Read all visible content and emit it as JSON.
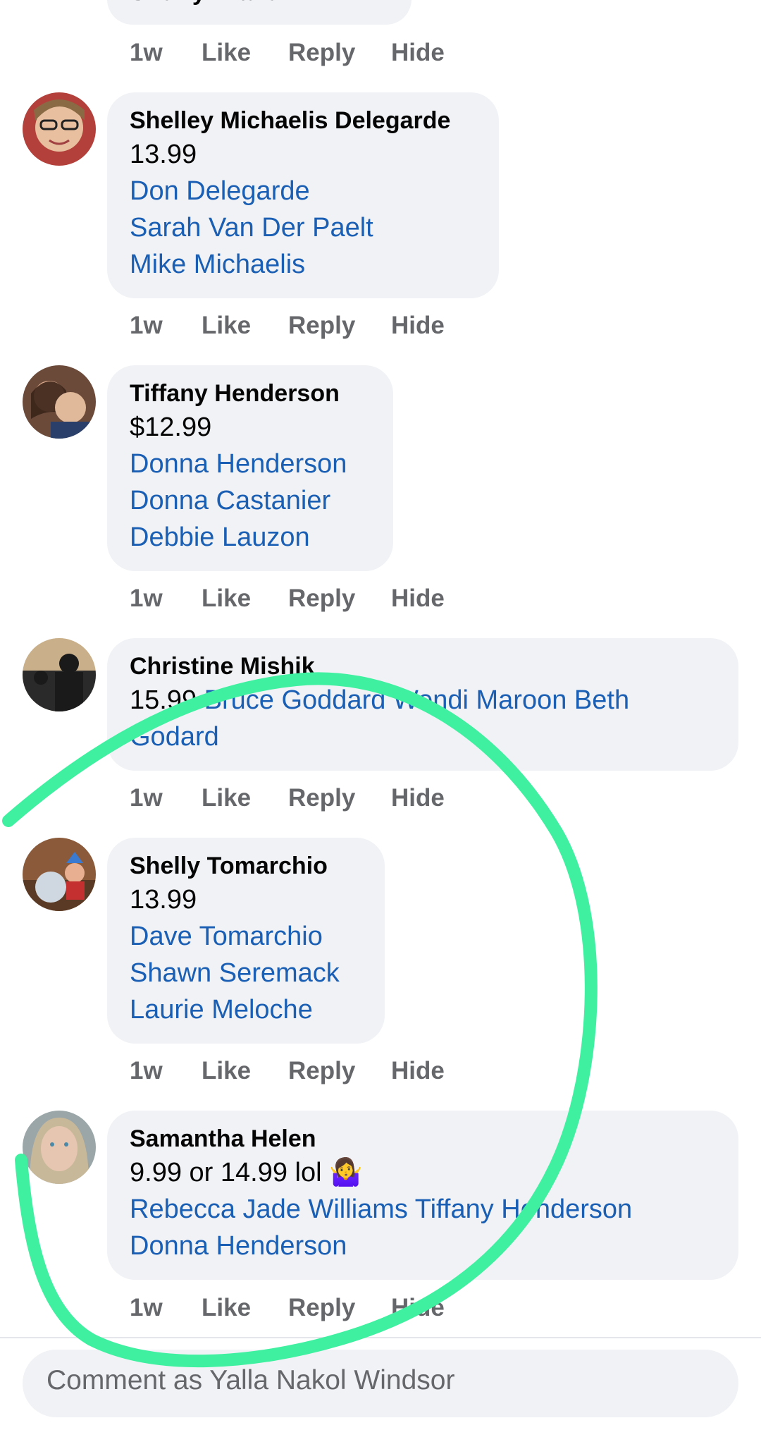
{
  "top_comment": {
    "author": "Sherry Drake",
    "actions": {
      "time": "1w",
      "like": "Like",
      "reply": "Reply",
      "hide": "Hide"
    }
  },
  "comments": [
    {
      "author": "Shelley Michaelis Delegarde",
      "text": "13.99",
      "tags": [
        "Don Delegarde",
        "Sarah Van Der Paelt",
        "Mike Michaelis"
      ],
      "actions": {
        "time": "1w",
        "like": "Like",
        "reply": "Reply",
        "hide": "Hide"
      }
    },
    {
      "author": "Tiffany Henderson",
      "text": "$12.99",
      "tags": [
        "Donna Henderson",
        "Donna Castanier",
        "Debbie Lauzon"
      ],
      "actions": {
        "time": "1w",
        "like": "Like",
        "reply": "Reply",
        "hide": "Hide"
      }
    },
    {
      "author": "Christine Mishik",
      "text": "15.99",
      "tags_line1": "Bruce Goddard Wendi Maroon Beth",
      "tags_line2": "Godard",
      "actions": {
        "time": "1w",
        "like": "Like",
        "reply": "Reply",
        "hide": "Hide"
      }
    },
    {
      "author": "Shelly Tomarchio",
      "text": "13.99",
      "tags": [
        "Dave Tomarchio",
        "Shawn Seremack",
        "Laurie Meloche"
      ],
      "actions": {
        "time": "1w",
        "like": "Like",
        "reply": "Reply",
        "hide": "Hide"
      }
    },
    {
      "author": "Samantha Helen",
      "text": "9.99 or 14.99 lol",
      "emoji": "🤷‍♀️",
      "tags_line1": "Rebecca Jade Williams Tiffany Henderson",
      "tags_line2": "Donna Henderson",
      "actions": {
        "time": "1w",
        "like": "Like",
        "reply": "Reply",
        "hide": "Hide"
      }
    }
  ],
  "composer": {
    "placeholder": "Comment as Yalla Nakol Windsor"
  },
  "colors": {
    "link": "#1a5fb4",
    "bubble": "#f0f2f5",
    "meta": "#65676b",
    "annotation": "#3ef0a0"
  }
}
